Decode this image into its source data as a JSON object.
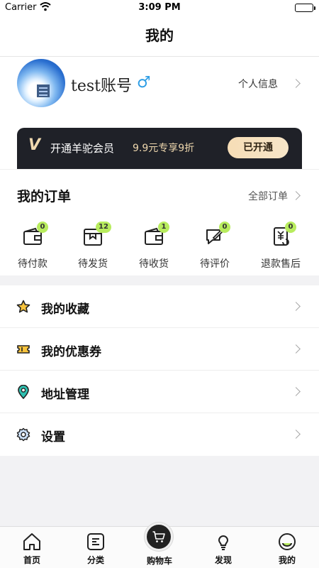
{
  "status_bar": {
    "carrier": "Carrier",
    "time": "3:09 PM"
  },
  "nav": {
    "title": "我的"
  },
  "profile": {
    "username": "test账号",
    "gender_symbol": "♂",
    "info_link": "个人信息"
  },
  "vip": {
    "logo": "V",
    "title": "开通羊驼会员",
    "promo": "9.9元专享9折",
    "button": "已开通"
  },
  "orders": {
    "heading": "我的订单",
    "all_link": "全部订单",
    "items": [
      {
        "label": "待付款",
        "badge": "0",
        "icon": "wallet-icon"
      },
      {
        "label": "待发货",
        "badge": "12",
        "icon": "package-icon"
      },
      {
        "label": "待收货",
        "badge": "1",
        "icon": "wallet-icon"
      },
      {
        "label": "待评价",
        "badge": "0",
        "icon": "comment-edit-icon"
      },
      {
        "label": "退款售后",
        "badge": "0",
        "icon": "refund-icon"
      }
    ]
  },
  "menu": {
    "items": [
      {
        "label": "我的收藏",
        "icon": "star-icon"
      },
      {
        "label": "我的优惠券",
        "icon": "ticket-icon"
      },
      {
        "label": "地址管理",
        "icon": "location-pin-icon"
      },
      {
        "label": "设置",
        "icon": "gear-icon"
      }
    ]
  },
  "tabbar": {
    "items": [
      {
        "label": "首页",
        "icon": "home-icon"
      },
      {
        "label": "分类",
        "icon": "category-icon"
      },
      {
        "label": "购物车",
        "icon": "cart-icon"
      },
      {
        "label": "发现",
        "icon": "lightbulb-icon"
      },
      {
        "label": "我的",
        "icon": "profile-icon"
      }
    ]
  },
  "colors": {
    "badge": "#b8ec5e",
    "vip_bg": "#1f2128",
    "vip_gold": "#f0d9b0",
    "gender_blue": "#2f9ee5",
    "star_yellow": "#f7c33c",
    "pin_teal": "#2ec0b0"
  }
}
